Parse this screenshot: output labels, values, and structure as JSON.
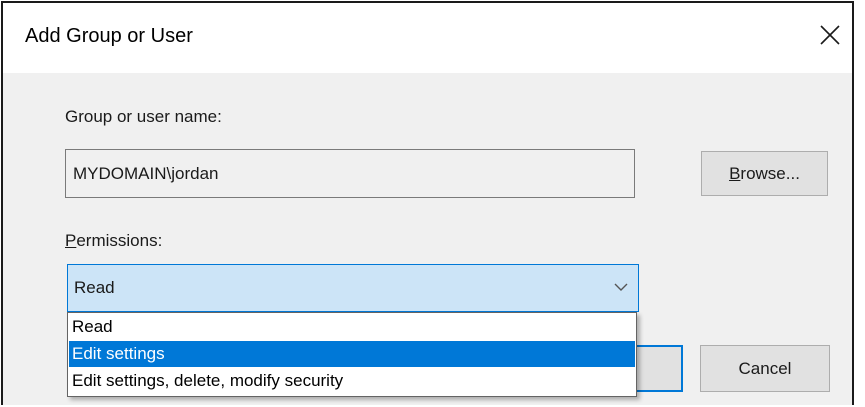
{
  "window": {
    "title": "Add Group or User",
    "close_icon": "close-icon"
  },
  "form": {
    "name_label": "Group or user name:",
    "name_value": "MYDOMAIN\\jordan",
    "browse_first": "B",
    "browse_rest": "rowse...",
    "permissions_first": "P",
    "permissions_rest": "ermissions:"
  },
  "permissions": {
    "selected": "Read",
    "options": [
      "Read",
      "Edit settings",
      "Edit settings, delete, modify security"
    ],
    "highlighted_index": 1
  },
  "buttons": {
    "cancel": "Cancel"
  },
  "colors": {
    "accent": "#0078d7",
    "select_background": "#cce4f7",
    "dialog_background": "#f0f0f0"
  }
}
